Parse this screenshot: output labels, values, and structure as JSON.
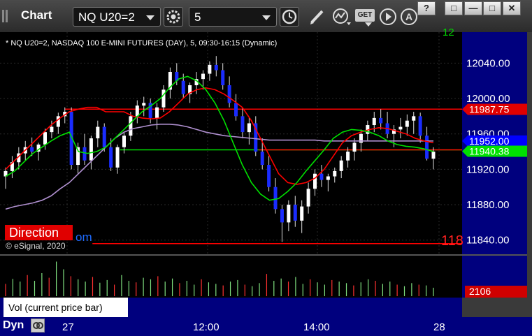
{
  "toolbar": {
    "title": "Chart",
    "symbol": "NQ U20=2",
    "interval": "5",
    "get_label": "GET"
  },
  "window_buttons": [
    "?",
    "□",
    "—",
    "✕"
  ],
  "chart_header": "* NQ U20=2, NASDAQ 100 E-MINI FUTURES (DAY), 5, 09:30-16:15 (Dynamic)",
  "copyright": "© eSignal, 2020",
  "direction_label": "Direction",
  "direction_suffix": "om",
  "cut_label_bottom": "118",
  "cut_label_top": "12",
  "volume_label": "Vol (current price bar)",
  "volume_close": "x",
  "dyn_label": "Dyn",
  "colors": {
    "up_candle": "#ffffff",
    "down_candle": "#1a2cff",
    "ma_red": "#ff0000",
    "ma_green": "#00e000",
    "ma_purple": "#b090d0",
    "level_red": "#ff0000",
    "level_green": "#00e000",
    "axis_bg": "#00007e"
  },
  "chart_data": {
    "type": "candlestick",
    "x_tick_labels": [
      "27",
      "12:00",
      "14:00",
      "28"
    ],
    "y_tick_labels": [
      "12040.00",
      "12000.00",
      "11960.00",
      "11920.00",
      "11880.00",
      "11840.00"
    ],
    "y_ticks": [
      12040,
      12000,
      11960,
      11920,
      11880,
      11840
    ],
    "ylim": [
      11824,
      12075
    ],
    "price_tags": [
      {
        "label": "11987.75",
        "value": 11987.75,
        "color": "#e00000"
      },
      {
        "label": "11952.00",
        "value": 11952.0,
        "color": "#0000ff"
      },
      {
        "label": "11940.38",
        "value": 11940.38,
        "color": "#00e000"
      }
    ],
    "horizontal_levels": [
      {
        "value": 11988,
        "color": "#ff0000",
        "x_start": 0.14
      },
      {
        "value": 11942,
        "color": "#00e000",
        "x_start": 0.26
      },
      {
        "value": 11942,
        "color": "#ff0000",
        "x_start": 0.56
      },
      {
        "value": 11836,
        "color": "#ff0000",
        "x_start": 0.2
      }
    ],
    "candles": [
      [
        11912,
        11922,
        11898,
        11918
      ],
      [
        11918,
        11935,
        11910,
        11928
      ],
      [
        11928,
        11945,
        11920,
        11938
      ],
      [
        11938,
        11952,
        11930,
        11945
      ],
      [
        11945,
        11956,
        11935,
        11940
      ],
      [
        11940,
        11950,
        11930,
        11948
      ],
      [
        11948,
        11966,
        11942,
        11962
      ],
      [
        11962,
        11975,
        11955,
        11968
      ],
      [
        11968,
        11984,
        11960,
        11980
      ],
      [
        11980,
        11990,
        11972,
        11985
      ],
      [
        11985,
        11990,
        11920,
        11925
      ],
      [
        11925,
        11950,
        11915,
        11945
      ],
      [
        11945,
        11960,
        11925,
        11930
      ],
      [
        11930,
        11958,
        11920,
        11955
      ],
      [
        11955,
        11975,
        11945,
        11968
      ],
      [
        11968,
        11972,
        11940,
        11945
      ],
      [
        11945,
        11955,
        11918,
        11922
      ],
      [
        11922,
        11948,
        11915,
        11945
      ],
      [
        11945,
        11962,
        11938,
        11958
      ],
      [
        11958,
        11985,
        11952,
        11980
      ],
      [
        11980,
        11998,
        11972,
        11992
      ],
      [
        11992,
        12002,
        11980,
        11995
      ],
      [
        11995,
        12000,
        11972,
        11978
      ],
      [
        11978,
        11995,
        11965,
        11990
      ],
      [
        11990,
        12015,
        11985,
        12010
      ],
      [
        12010,
        12035,
        12000,
        12030
      ],
      [
        12030,
        12040,
        12015,
        12020
      ],
      [
        12020,
        12028,
        12000,
        12005
      ],
      [
        12005,
        12018,
        11995,
        12015
      ],
      [
        12015,
        12030,
        12005,
        12022
      ],
      [
        12022,
        12032,
        12010,
        12028
      ],
      [
        12028,
        12042,
        12020,
        12038
      ],
      [
        12038,
        12048,
        12025,
        12032
      ],
      [
        12032,
        12040,
        12010,
        12015
      ],
      [
        12015,
        12025,
        11990,
        11995
      ],
      [
        11995,
        12005,
        11975,
        11980
      ],
      [
        11980,
        11990,
        11955,
        11962
      ],
      [
        11962,
        11978,
        11948,
        11972
      ],
      [
        11972,
        11980,
        11935,
        11940
      ],
      [
        11940,
        11955,
        11920,
        11925
      ],
      [
        11925,
        11935,
        11895,
        11900
      ],
      [
        11900,
        11910,
        11870,
        11875
      ],
      [
        11875,
        11880,
        11838,
        11860
      ],
      [
        11860,
        11885,
        11850,
        11880
      ],
      [
        11880,
        11890,
        11855,
        11862
      ],
      [
        11862,
        11885,
        11848,
        11878
      ],
      [
        11878,
        11905,
        11870,
        11898
      ],
      [
        11898,
        11920,
        11890,
        11915
      ],
      [
        11915,
        11925,
        11900,
        11908
      ],
      [
        11908,
        11915,
        11895,
        11912
      ],
      [
        11912,
        11922,
        11905,
        11918
      ],
      [
        11918,
        11935,
        11910,
        11930
      ],
      [
        11930,
        11945,
        11922,
        11940
      ],
      [
        11940,
        11955,
        11930,
        11950
      ],
      [
        11950,
        11965,
        11940,
        11960
      ],
      [
        11960,
        11975,
        11952,
        11970
      ],
      [
        11970,
        11985,
        11962,
        11978
      ],
      [
        11978,
        11988,
        11965,
        11972
      ],
      [
        11972,
        11985,
        11955,
        11960
      ],
      [
        11960,
        11970,
        11945,
        11965
      ],
      [
        11965,
        11978,
        11955,
        11968
      ],
      [
        11968,
        11982,
        11958,
        11975
      ],
      [
        11975,
        11985,
        11960,
        11980
      ],
      [
        11980,
        11984,
        11950,
        11958
      ],
      [
        11958,
        11968,
        11930,
        11932
      ],
      [
        11932,
        11945,
        11920,
        11940
      ]
    ],
    "ma_red": [
      11920,
      11930,
      11940,
      11950,
      11960,
      11970,
      11978,
      11985,
      11988,
      11990,
      11990,
      11985,
      11985,
      11985,
      11980,
      11978,
      11977,
      11978,
      11985,
      11995,
      12005,
      12010,
      12012,
      12010,
      12005,
      11998,
      11990,
      11975,
      11955,
      11935,
      11915,
      11905,
      11903,
      11905,
      11910,
      11920,
      11935,
      11950,
      11958,
      11962,
      11965,
      11967,
      11966,
      11963,
      11960,
      11955,
      11952,
      11950
    ],
    "ma_green": [
      11912,
      11918,
      11928,
      11938,
      11945,
      11952,
      11958,
      11962,
      11940,
      11938,
      11940,
      11945,
      11955,
      11965,
      11975,
      11985,
      11992,
      12000,
      12012,
      12022,
      12025,
      12020,
      12010,
      11995,
      11975,
      11950,
      11925,
      11905,
      11892,
      11885,
      11887,
      11895,
      11905,
      11918,
      11930,
      11942,
      11955,
      11962,
      11965,
      11964,
      11962,
      11958,
      11952,
      11948,
      11946,
      11945,
      11943,
      11940
    ],
    "ma_purple": [
      11875,
      11878,
      11880,
      11882,
      11885,
      11890,
      11898,
      11905,
      11915,
      11925,
      11935,
      11945,
      11955,
      11962,
      11966,
      11968,
      11970,
      11971,
      11971,
      11970,
      11968,
      11965,
      11962,
      11960,
      11958,
      11957,
      11956,
      11955,
      11954,
      11953,
      11953,
      11953,
      11953,
      11953,
      11953,
      11952,
      11952,
      11952,
      11952,
      11952,
      11952,
      11952,
      11952,
      11952,
      11952,
      11952,
      11952,
      11952
    ],
    "volume": {
      "value_label": "2106",
      "value": 2106,
      "bars": [
        32,
        45,
        38,
        55,
        40,
        60,
        48,
        90,
        70,
        52,
        44,
        38,
        50,
        35,
        42,
        30,
        55,
        40,
        36,
        48,
        44,
        52,
        38,
        46,
        34,
        40,
        30,
        44,
        36,
        32,
        28,
        38,
        42,
        30,
        26,
        34,
        58,
        40,
        46,
        38,
        50,
        32,
        44,
        36,
        30,
        42,
        38,
        34,
        28,
        36,
        44,
        40,
        32,
        38,
        30,
        26,
        34,
        30,
        28,
        22
      ]
    }
  }
}
